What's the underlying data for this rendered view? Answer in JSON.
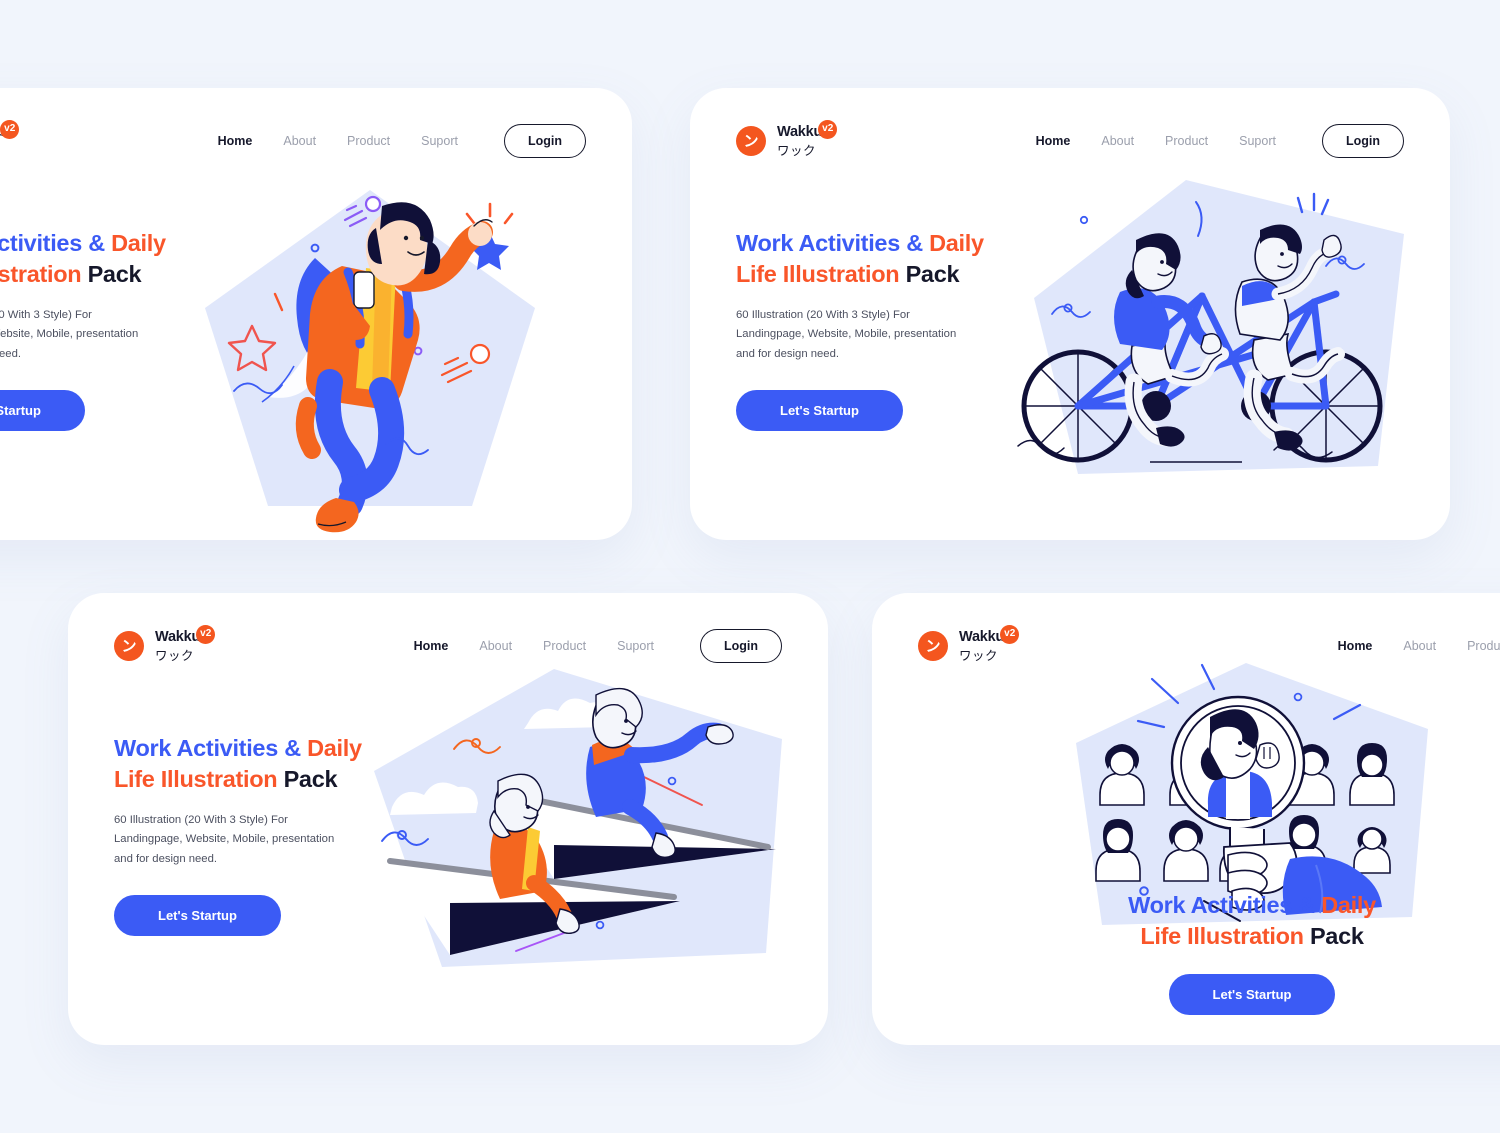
{
  "page": {
    "background_color": "#f1f5fc",
    "card_background": "#ffffff"
  },
  "colors": {
    "brand_orange": "#f4561f",
    "headline_blue": "#3b5bf5",
    "headline_orange": "#f9562a",
    "headline_dark": "#16182b",
    "cta_blue": "#3b5bf5",
    "illustration_bg": "#e0e7fb",
    "illustration_navy": "#101038",
    "nav_muted": "#9b9fac"
  },
  "brand": {
    "mark_glyph": "ン",
    "mark_icon": "wakku-swoosh-icon",
    "name": "Wakku",
    "badge": "v2",
    "subtitle": "ワック"
  },
  "nav": {
    "items": [
      {
        "label": "Home",
        "active": true
      },
      {
        "label": "About",
        "active": false
      },
      {
        "label": "Product",
        "active": false
      },
      {
        "label": "Suport",
        "active": false
      }
    ],
    "login_label": "Login"
  },
  "hero": {
    "headline_line1_blue": "Work Activities &",
    "headline_line1_orange": "Daily",
    "headline_line2_orange": "Life Illustration",
    "headline_line2_dark": "Pack",
    "body": "60 Illustration (20 With 3 Style) For Landingpage, Website, Mobile, presentation and for design need.",
    "cta_label": "Let's Startup"
  },
  "cards": [
    {
      "id": "card-top-left",
      "position": "top-left",
      "clipped": true,
      "has_login": true,
      "has_body_text": true,
      "layout": "text-left-art-right",
      "illustration": "person-reaching-star-with-jetpack"
    },
    {
      "id": "card-top-right",
      "position": "top-right",
      "clipped": false,
      "has_login": true,
      "has_body_text": true,
      "layout": "text-left-art-right",
      "illustration": "two-people-riding-tandem-bicycle"
    },
    {
      "id": "card-bottom-left",
      "position": "bottom-left",
      "clipped": false,
      "has_login": true,
      "has_body_text": true,
      "layout": "text-left-art-right",
      "illustration": "two-people-riding-paper-planes"
    },
    {
      "id": "card-bottom-right",
      "position": "bottom-right",
      "clipped": false,
      "has_login": false,
      "has_body_text": false,
      "layout": "art-top-text-centered-below",
      "illustration": "magnifying-glass-searching-people-avatars"
    }
  ]
}
